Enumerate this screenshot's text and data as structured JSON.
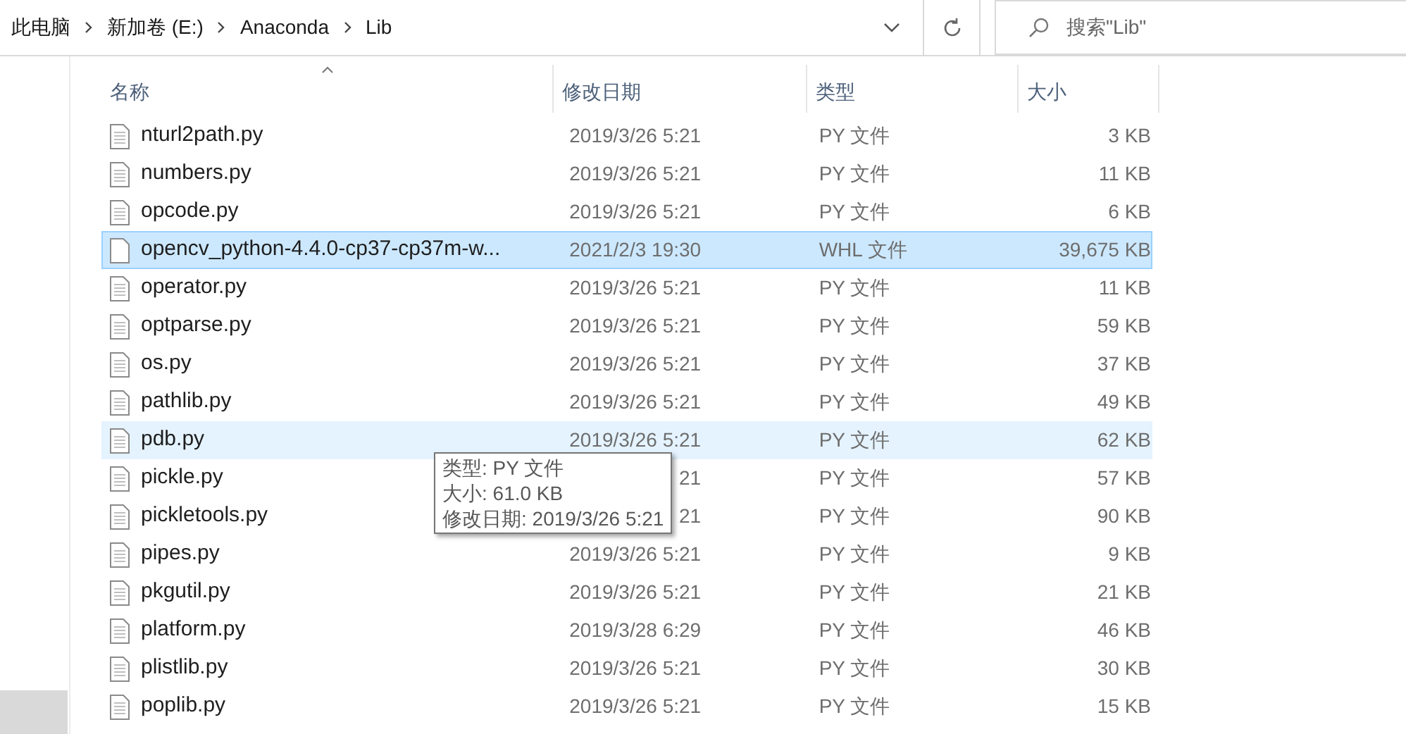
{
  "breadcrumb": [
    {
      "label": "此电脑"
    },
    {
      "label": "新加卷 (E:)"
    },
    {
      "label": "Anaconda"
    },
    {
      "label": "Lib"
    }
  ],
  "search": {
    "placeholder": "搜索\"Lib\""
  },
  "columns": [
    {
      "label": "名称",
      "sorted": true
    },
    {
      "label": "修改日期",
      "sorted": false
    },
    {
      "label": "类型",
      "sorted": false
    },
    {
      "label": "大小",
      "sorted": false
    }
  ],
  "rows": [
    {
      "name": "nturl2path.py",
      "date": "2019/3/26 5:21",
      "type": "PY 文件",
      "size": "3 KB",
      "selected": false,
      "hovered": false
    },
    {
      "name": "numbers.py",
      "date": "2019/3/26 5:21",
      "type": "PY 文件",
      "size": "11 KB",
      "selected": false,
      "hovered": false
    },
    {
      "name": "opcode.py",
      "date": "2019/3/26 5:21",
      "type": "PY 文件",
      "size": "6 KB",
      "selected": false,
      "hovered": false
    },
    {
      "name": "opencv_python-4.4.0-cp37-cp37m-w...",
      "date": "2021/2/3 19:30",
      "type": "WHL 文件",
      "size": "39,675 KB",
      "selected": true,
      "hovered": false
    },
    {
      "name": "operator.py",
      "date": "2019/3/26 5:21",
      "type": "PY 文件",
      "size": "11 KB",
      "selected": false,
      "hovered": false
    },
    {
      "name": "optparse.py",
      "date": "2019/3/26 5:21",
      "type": "PY 文件",
      "size": "59 KB",
      "selected": false,
      "hovered": false
    },
    {
      "name": "os.py",
      "date": "2019/3/26 5:21",
      "type": "PY 文件",
      "size": "37 KB",
      "selected": false,
      "hovered": false
    },
    {
      "name": "pathlib.py",
      "date": "2019/3/26 5:21",
      "type": "PY 文件",
      "size": "49 KB",
      "selected": false,
      "hovered": false
    },
    {
      "name": "pdb.py",
      "date": "2019/3/26 5:21",
      "type": "PY 文件",
      "size": "62 KB",
      "selected": false,
      "hovered": true
    },
    {
      "name": "pickle.py",
      "date": "21",
      "type": "PY 文件",
      "size": "57 KB",
      "selected": false,
      "hovered": false
    },
    {
      "name": "pickletools.py",
      "date": "21",
      "type": "PY 文件",
      "size": "90 KB",
      "selected": false,
      "hovered": false
    },
    {
      "name": "pipes.py",
      "date": "2019/3/26 5:21",
      "type": "PY 文件",
      "size": "9 KB",
      "selected": false,
      "hovered": false
    },
    {
      "name": "pkgutil.py",
      "date": "2019/3/26 5:21",
      "type": "PY 文件",
      "size": "21 KB",
      "selected": false,
      "hovered": false
    },
    {
      "name": "platform.py",
      "date": "2019/3/28 6:29",
      "type": "PY 文件",
      "size": "46 KB",
      "selected": false,
      "hovered": false
    },
    {
      "name": "plistlib.py",
      "date": "2019/3/26 5:21",
      "type": "PY 文件",
      "size": "30 KB",
      "selected": false,
      "hovered": false
    },
    {
      "name": "poplib.py",
      "date": "2019/3/26 5:21",
      "type": "PY 文件",
      "size": "15 KB",
      "selected": false,
      "hovered": false
    }
  ],
  "tooltip": {
    "lines": [
      "类型: PY 文件",
      "大小: 61.0 KB",
      "修改日期: 2019/3/26 5:21"
    ]
  }
}
